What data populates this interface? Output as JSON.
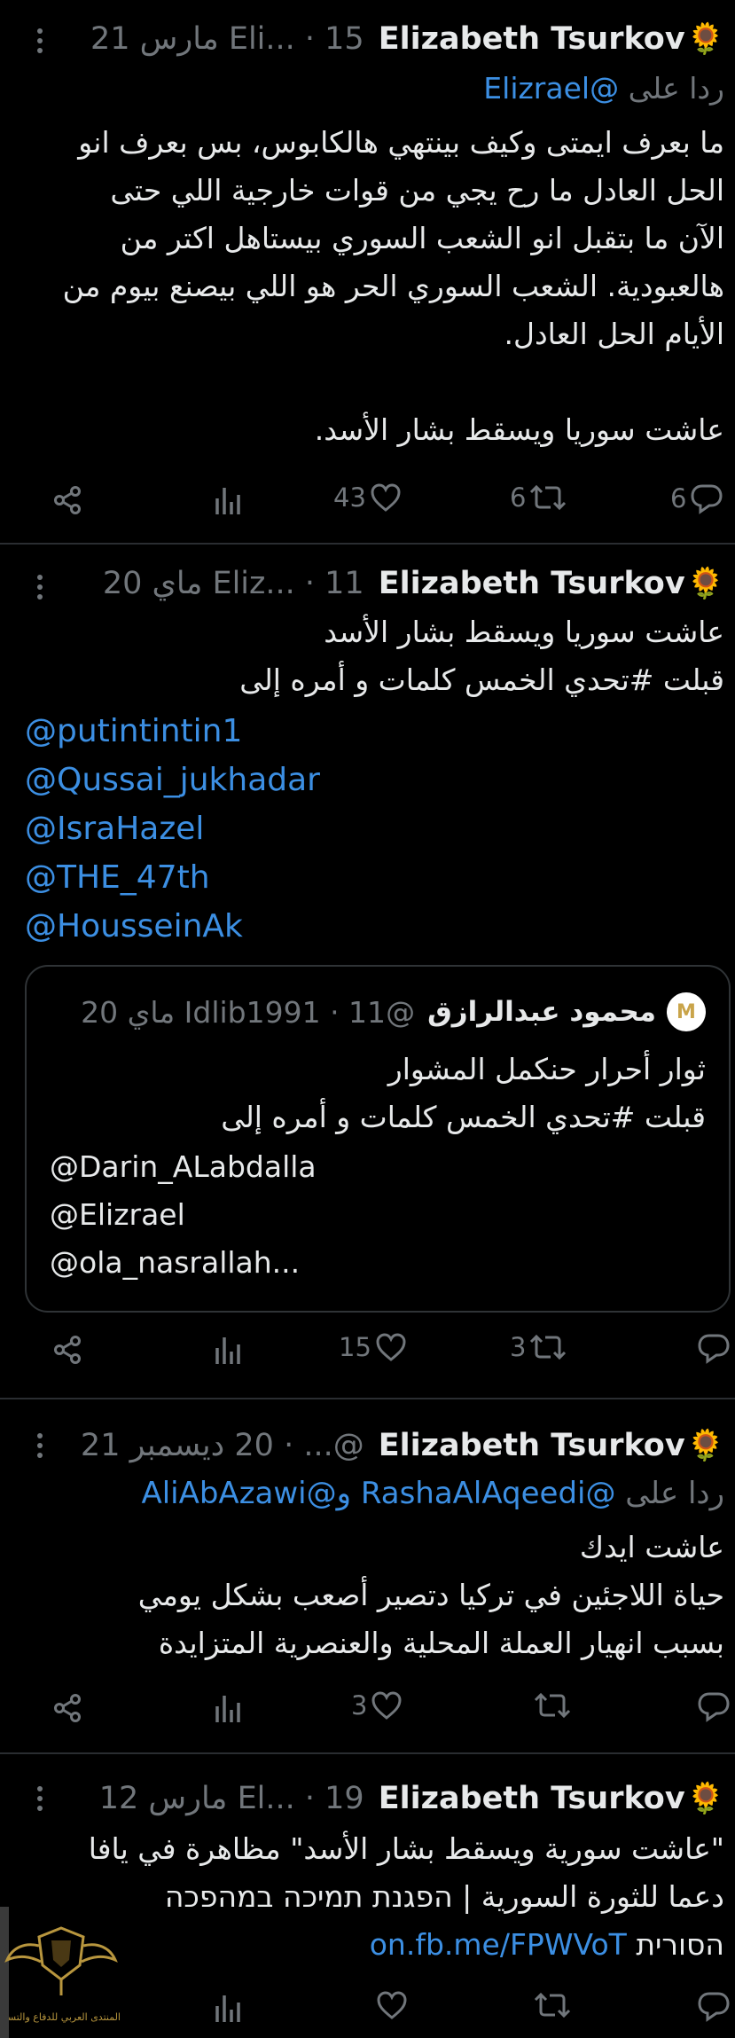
{
  "colors": {
    "background": "#000000",
    "text": "#e7e9ea",
    "muted": "#71767b",
    "link": "#3c8fe3",
    "divider": "#2a2d31"
  },
  "tweets": [
    {
      "display_name": "Elizabeth Tsurkov",
      "emoji": "🌻",
      "meta": "Eli... · 15 مارس 21",
      "reply_prefix": "ردا على",
      "reply_users": "@Elizrael",
      "text_lines": [
        "ما بعرف ايمتى وكيف بينتهي هالكابوس، بس بعرف انو",
        "الحل العادل ما رح يجي من قوات خارجية اللي حتى",
        "الآن ما بتقبل انو الشعب السوري بيستاهل اكتر من",
        "هالعبودية. الشعب السوري الحر هو اللي بيصنع بيوم من",
        "الأيام الحل العادل.",
        "",
        "عاشت سوريا ويسقط بشار الأسد."
      ],
      "replies": "6",
      "retweets": "6",
      "likes": "43"
    },
    {
      "display_name": "Elizabeth Tsurkov",
      "emoji": "🌻",
      "meta": "Eliz... · 11 ماي 20",
      "text_lines": [
        "عاشت سوريا ويسقط بشار الأسد",
        "قبلت #تحدي الخمس كلمات و أمره إلى"
      ],
      "mentions": [
        "@putintintin1",
        "@Qussai_jukhadar",
        "@IsraHazel",
        "@THE_47th",
        "@HousseinAk"
      ],
      "quote": {
        "name": "محمود عبدالرازق",
        "meta": "@Idlib1991 · 11 ماي 20",
        "avatar_letter": "M",
        "lines": [
          "ثوار أحرار حنكمل المشوار",
          "قبلت #تحدي الخمس كلمات و أمره إلى"
        ],
        "mentions": [
          "@Darin_ALabdalla",
          "@Elizrael",
          "@ola_nasrallah..."
        ]
      },
      "replies": "",
      "retweets": "3",
      "likes": "15"
    },
    {
      "display_name": "Elizabeth Tsurkov",
      "emoji": "🌻",
      "meta": "@... · 20 ديسمبر 21",
      "reply_prefix": "ردا على",
      "reply_users": "@RashaAlAqeedi و@AliAbAzawi",
      "text_lines": [
        "عاشت ايدك",
        "حياة اللاجئين في تركيا دتصير أصعب بشكل يومي",
        "بسبب انهيار العملة المحلية والعنصرية المتزايدة"
      ],
      "replies": "",
      "retweets": "",
      "likes": "3"
    },
    {
      "display_name": "Elizabeth Tsurkov",
      "emoji": "🌻",
      "meta": "El... · 19 مارس 12",
      "text_lines": [
        "\"عاشت سورية ويسقط بشار الأسد\" مظاهرة في يافا",
        "دعما للثورة السورية | הפגנת תמיכה במהפכה",
        "הסורית"
      ],
      "link": "on.fb.me/FPWVoT",
      "replies": "",
      "retweets": "",
      "likes": ""
    }
  ],
  "watermark": {
    "caption": "المنتدى العربي للدفاع والتسليح"
  }
}
